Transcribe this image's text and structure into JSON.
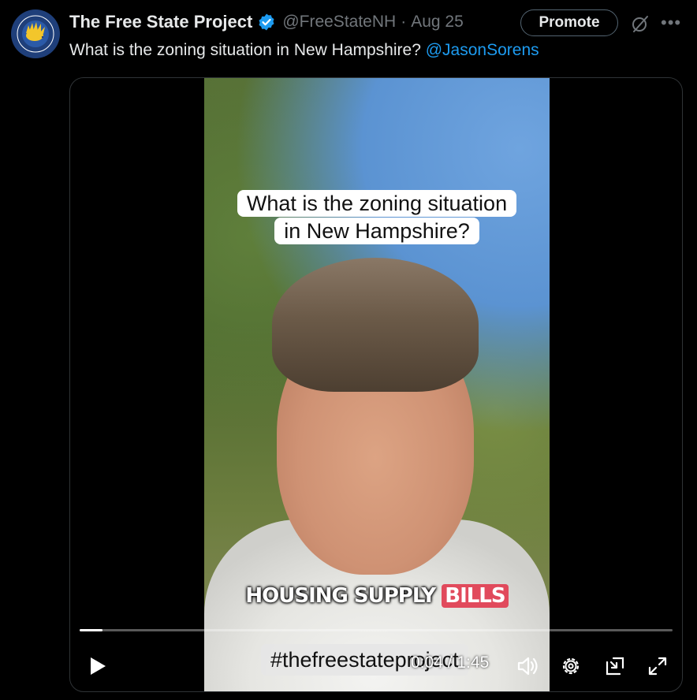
{
  "tweet": {
    "author_name": "The Free State Project",
    "handle": "@FreeStateNH",
    "separator": "·",
    "date": "Aug 25",
    "promote_label": "Promote",
    "more_label": "•••",
    "text": "What is the zoning situation in New Hampshire?",
    "mention": "@JasonSorens",
    "avatar_icon": "free-state-project-logo",
    "verified_color": "#1d9bf0"
  },
  "video": {
    "caption_line1": "What is the zoning situation",
    "caption_line2": "in New Hampshire?",
    "lower_title_main": "HOUSING SUPPLY ",
    "lower_title_highlight": "BILLS",
    "hashtag": "#thefreestateproject",
    "time_display": "0:04 / 1:45",
    "progress": 0.038,
    "accent_highlight": "#e14a5c"
  }
}
